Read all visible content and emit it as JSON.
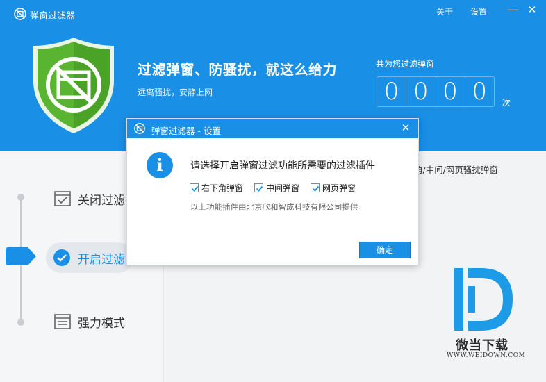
{
  "app": {
    "title": "弹窗过滤器",
    "about_label": "关于",
    "settings_label": "设置",
    "minimize_glyph": "—",
    "close_glyph": "✕"
  },
  "hero": {
    "headline": "过滤弹窗、防骚扰，就这么给力",
    "subline": "远离骚扰，安静上网"
  },
  "counter": {
    "label": "共为您过滤弹窗",
    "digits": [
      "0",
      "0",
      "0",
      "0"
    ],
    "unit": "次"
  },
  "modes": [
    {
      "label": "关闭过滤",
      "icon": "window-check-icon",
      "active": false
    },
    {
      "label": "开启过滤",
      "icon": "check-circle-icon",
      "active": true
    },
    {
      "label": "强力模式",
      "icon": "window-stack-icon",
      "active": false
    }
  ],
  "right_panel": {
    "text": "角/中间/网页骚扰弹窗"
  },
  "dialog": {
    "title": "弹窗过滤器 - 设置",
    "close_glyph": "✕",
    "info_glyph": "i",
    "message": "请选择开启弹窗过滤功能所需要的过滤插件",
    "options": [
      {
        "label": "右下角弹窗",
        "checked": true
      },
      {
        "label": "中间弹窗",
        "checked": true
      },
      {
        "label": "网页弹窗",
        "checked": true
      }
    ],
    "note": "以上功能插件由北京欣和智成科技有限公司提供",
    "ok_label": "确定"
  },
  "watermark": {
    "name": "微当下载",
    "url": "WWW.WEIDOWN.COM"
  },
  "colors": {
    "primary": "#1a8fe6",
    "shield_green": "#58b431",
    "shield_green_dark": "#3f9a22"
  }
}
